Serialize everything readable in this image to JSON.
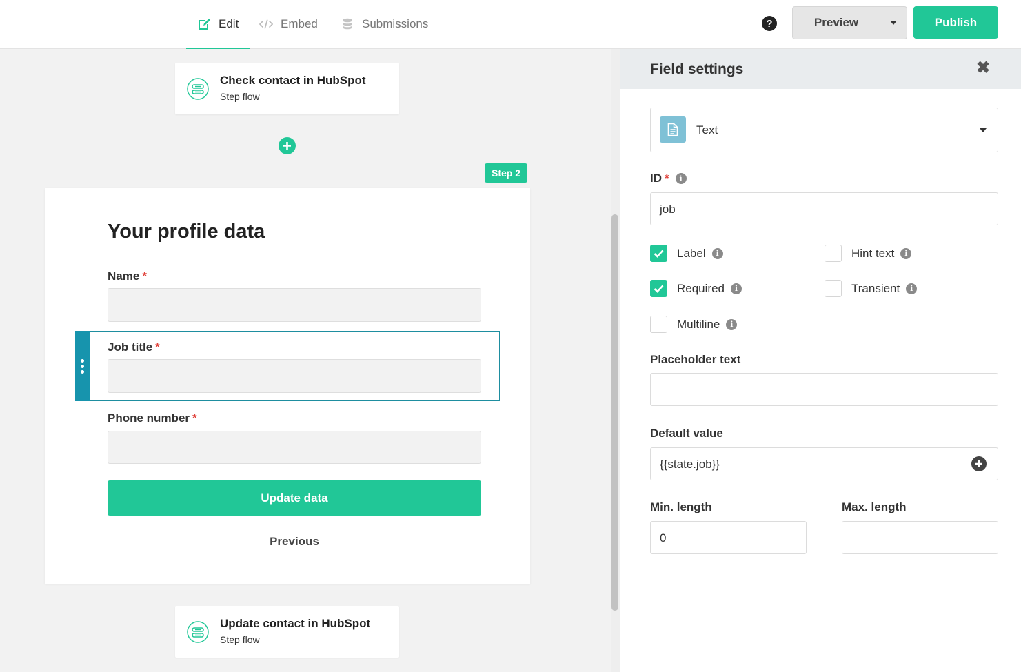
{
  "topbar": {
    "tabs": [
      {
        "label": "Edit",
        "icon": "edit-icon",
        "active": true
      },
      {
        "label": "Embed",
        "icon": "code-icon",
        "active": false
      },
      {
        "label": "Submissions",
        "icon": "database-icon",
        "active": false
      }
    ],
    "help_icon": "?",
    "preview_label": "Preview",
    "publish_label": "Publish",
    "accent_color": "#21c797"
  },
  "canvas": {
    "step_before": {
      "title": "Check contact in HubSpot",
      "subtitle": "Step flow"
    },
    "step_badge": "Step 2",
    "form": {
      "title": "Your profile data",
      "fields": [
        {
          "label": "Name",
          "required_mark": "*"
        },
        {
          "label": "Job title",
          "required_mark": "*",
          "selected": true
        },
        {
          "label": "Phone number",
          "required_mark": "*"
        }
      ],
      "submit_label": "Update data",
      "previous_label": "Previous"
    },
    "step_after": {
      "title": "Update contact in HubSpot",
      "subtitle": "Step flow"
    }
  },
  "panel": {
    "title": "Field settings",
    "close_icon": "✖",
    "field_type": "Text",
    "id_label": "ID",
    "id_required_mark": "*",
    "id_value": "job",
    "options": {
      "label": {
        "text": "Label",
        "checked": true
      },
      "hint_text": {
        "text": "Hint text",
        "checked": false
      },
      "required": {
        "text": "Required",
        "checked": true
      },
      "transient": {
        "text": "Transient",
        "checked": false
      },
      "multiline": {
        "text": "Multiline",
        "checked": false
      }
    },
    "placeholder_label": "Placeholder text",
    "placeholder_value": "",
    "default_label": "Default value",
    "default_value": "{{state.job}}",
    "min_label": "Min. length",
    "min_value": "0",
    "max_label": "Max. length",
    "max_value": ""
  }
}
